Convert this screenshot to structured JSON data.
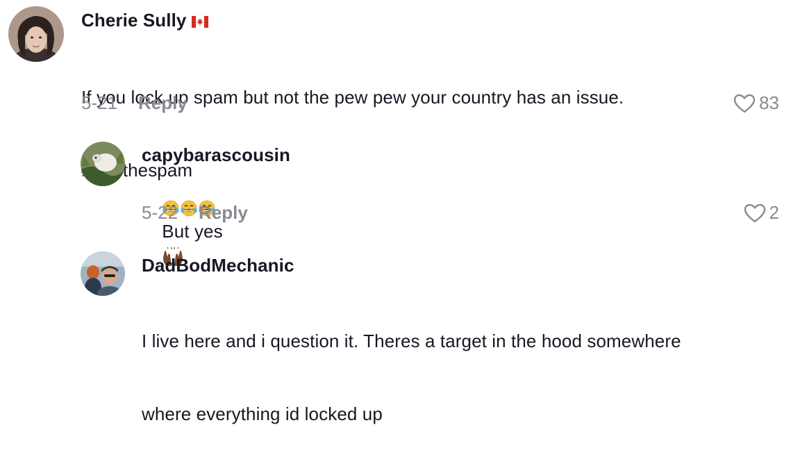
{
  "comments": [
    {
      "username": "Cherie Sully",
      "flag": "canada-flag-icon",
      "lines": [
        "If you lock up spam but not the pew pew your country has an issue.",
        "#freethespam"
      ],
      "date": "5-21",
      "reply": "Reply",
      "likes": "83"
    },
    {
      "username": "capybarascousin",
      "text": "But yes",
      "emoji_before": [
        "tears-of-joy-emoji",
        "tears-of-joy-emoji",
        "tears-of-joy-emoji"
      ],
      "emoji_after": "raising-hands-emoji",
      "date": "5-22",
      "reply": "Reply",
      "likes": "2"
    },
    {
      "username": "DadBodMechanic",
      "lines": [
        "I live here and i question it. Theres a target in the hood somewhere",
        "where everything id locked up"
      ]
    }
  ],
  "colors": {
    "text": "#161823",
    "muted": "#8a8b91",
    "background": "#ffffff"
  }
}
